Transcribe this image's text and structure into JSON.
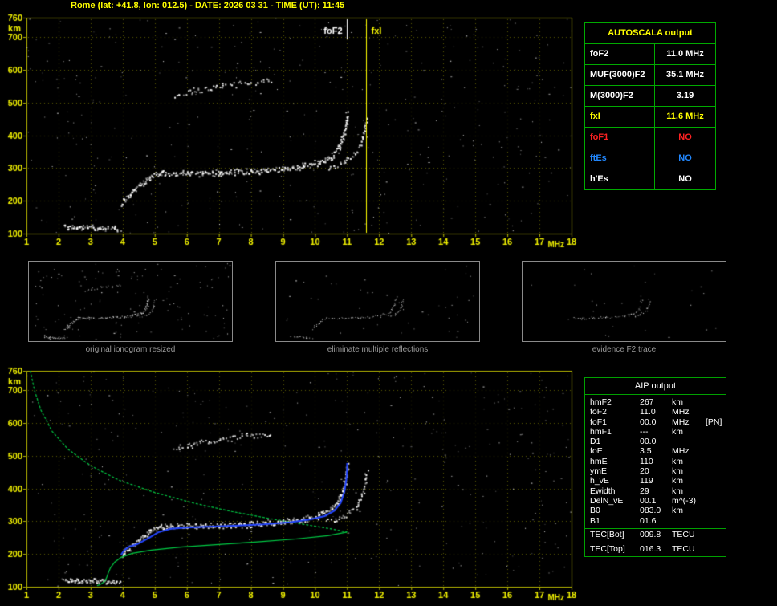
{
  "title": "Rome (lat: +41.8, lon: 012.5) - DATE: 2026 03 31 - TIME (UT): 11:45",
  "colors": {
    "title": "#ffff00",
    "plot_frame": "#b8b800",
    "grid": "#7a7a00",
    "axis_label": "#f0f000",
    "table_border": "#00aa00",
    "caption": "#9a9a9a",
    "profile_green": "#00cc44",
    "trace_blue": "#2244ff",
    "status_red": "#ff2222",
    "status_blue": "#2288ff",
    "status_yellow": "#ffff00",
    "status_white": "#ffffff"
  },
  "autoscala": {
    "header": "AUTOSCALA output",
    "rows": [
      {
        "label": "foF2",
        "value": "11.0 MHz",
        "color": "white"
      },
      {
        "label": "MUF(3000)F2",
        "value": "35.1 MHz",
        "color": "white"
      },
      {
        "label": "M(3000)F2",
        "value": "3.19",
        "color": "white"
      },
      {
        "label": "fxI",
        "value": "11.6 MHz",
        "color": "yellow"
      },
      {
        "label": "foF1",
        "value": "NO",
        "color": "red"
      },
      {
        "label": "ftEs",
        "value": "NO",
        "color": "blue"
      },
      {
        "label": "h'Es",
        "value": "NO",
        "color": "white"
      }
    ]
  },
  "aip": {
    "header": "AIP output",
    "rows": [
      {
        "name": "hmF2",
        "value": "267",
        "unit": "km",
        "note": ""
      },
      {
        "name": "foF2",
        "value": "11.0",
        "unit": "MHz",
        "note": ""
      },
      {
        "name": "foF1",
        "value": "00.0",
        "unit": "MHz",
        "note": "[PN]"
      },
      {
        "name": "hmF1",
        "value": "---",
        "unit": "km",
        "note": ""
      },
      {
        "name": "D1",
        "value": "00.0",
        "unit": "",
        "note": ""
      },
      {
        "name": "foE",
        "value": "3.5",
        "unit": "MHz",
        "note": ""
      },
      {
        "name": "hmE",
        "value": "110",
        "unit": "km",
        "note": ""
      },
      {
        "name": "ymE",
        "value": "20",
        "unit": "km",
        "note": ""
      },
      {
        "name": "h_vE",
        "value": "119",
        "unit": "km",
        "note": ""
      },
      {
        "name": "Ewidth",
        "value": "29",
        "unit": "km",
        "note": ""
      },
      {
        "name": "DelN_vE",
        "value": "00.1",
        "unit": "m^(-3)",
        "note": ""
      },
      {
        "name": "B0",
        "value": "083.0",
        "unit": "km",
        "note": ""
      },
      {
        "name": "B1",
        "value": "01.6",
        "unit": "",
        "note": ""
      }
    ],
    "tec_rows": [
      {
        "name": "TEC[Bot]",
        "value": "009.8",
        "unit": "TECU"
      },
      {
        "name": "TEC[Top]",
        "value": "016.3",
        "unit": "TECU"
      }
    ]
  },
  "captions": [
    "original ionogram resized",
    "eliminate multiple reflections",
    "evidence F2 trace"
  ],
  "chart_data": [
    {
      "id": "main_ionogram",
      "type": "scatter",
      "xlabel": "MHz",
      "ylabel": "km",
      "xlim": [
        1,
        18
      ],
      "ylim": [
        100,
        760
      ],
      "xticks": [
        1,
        2,
        3,
        4,
        5,
        6,
        7,
        8,
        9,
        10,
        11,
        12,
        13,
        14,
        15,
        16,
        17,
        18
      ],
      "yticks": [
        100,
        200,
        300,
        400,
        500,
        600,
        700,
        760
      ],
      "grid": true,
      "markers": [
        {
          "label": "foF2",
          "freq_mhz": 11.0,
          "color": "#ffffff",
          "line": "short",
          "label_side": "left"
        },
        {
          "label": "fxI",
          "freq_mhz": 11.6,
          "color": "#ffff00",
          "line": "full",
          "label_side": "right"
        }
      ],
      "traces": [
        {
          "name": "E-region-echo",
          "points": [
            [
              2.15,
              124
            ],
            [
              2.6,
              121
            ],
            [
              3.2,
              119
            ],
            [
              3.9,
              116
            ]
          ],
          "spread": 4,
          "density": 2
        },
        {
          "name": "F-rise",
          "points": [
            [
              3.95,
              190
            ],
            [
              4.05,
              204
            ],
            [
              4.2,
              220
            ],
            [
              4.5,
              246
            ],
            [
              4.85,
              272
            ],
            [
              5.15,
              286
            ]
          ],
          "spread": 4,
          "density": 2
        },
        {
          "name": "F2-flat",
          "points": [
            [
              5.15,
              287
            ],
            [
              6.0,
              286
            ],
            [
              7.0,
              288
            ],
            [
              8.0,
              292
            ],
            [
              9.0,
              300
            ],
            [
              9.6,
              308
            ],
            [
              10.1,
              319
            ],
            [
              10.5,
              336
            ],
            [
              10.75,
              366
            ],
            [
              10.9,
              406
            ],
            [
              10.97,
              448
            ],
            [
              11.0,
              470
            ]
          ],
          "spread": 5,
          "density": 2
        },
        {
          "name": "F2-xray",
          "points": [
            [
              10.35,
              299
            ],
            [
              10.9,
              318
            ],
            [
              11.25,
              344
            ],
            [
              11.45,
              380
            ],
            [
              11.55,
              422
            ],
            [
              11.6,
              452
            ]
          ],
          "spread": 4,
          "density": 1
        },
        {
          "name": "second-hop",
          "points": [
            [
              5.6,
              522
            ],
            [
              6.3,
              541
            ],
            [
              7.1,
              554
            ],
            [
              7.9,
              562
            ],
            [
              8.6,
              568
            ]
          ],
          "spread": 5,
          "density": 1
        }
      ],
      "noise": {
        "count": 380
      }
    },
    {
      "id": "interpreted_ionogram_with_profile",
      "type": "scatter",
      "xlabel": "MHz",
      "ylabel": "km",
      "xlim": [
        1,
        18
      ],
      "ylim": [
        100,
        760
      ],
      "xticks": [
        1,
        2,
        3,
        4,
        5,
        6,
        7,
        8,
        9,
        10,
        11,
        12,
        13,
        14,
        15,
        16,
        17,
        18
      ],
      "yticks": [
        100,
        200,
        300,
        400,
        500,
        600,
        700,
        760
      ],
      "grid": true,
      "traces_from": 0,
      "noise": {
        "count": 340
      },
      "profile_topside": [
        [
          1.12,
          760
        ],
        [
          1.25,
          700
        ],
        [
          1.45,
          640
        ],
        [
          1.8,
          575
        ],
        [
          2.3,
          520
        ],
        [
          3.0,
          470
        ],
        [
          3.9,
          425
        ],
        [
          5.0,
          388
        ],
        [
          6.2,
          356
        ],
        [
          7.4,
          330
        ],
        [
          8.6,
          308
        ],
        [
          9.7,
          290
        ],
        [
          10.5,
          277
        ],
        [
          11.0,
          267
        ]
      ],
      "profile_bottomside": [
        [
          11.0,
          267
        ],
        [
          10.4,
          256
        ],
        [
          9.4,
          246
        ],
        [
          8.2,
          237
        ],
        [
          7.0,
          229
        ],
        [
          5.8,
          221
        ],
        [
          4.9,
          212
        ],
        [
          4.3,
          202
        ],
        [
          3.95,
          190
        ],
        [
          3.75,
          175
        ],
        [
          3.62,
          158
        ],
        [
          3.55,
          142
        ],
        [
          3.5,
          128
        ],
        [
          3.45,
          118
        ],
        [
          3.38,
          112
        ],
        [
          3.3,
          107
        ],
        [
          3.2,
          103
        ]
      ],
      "restored_trace": [
        [
          3.95,
          198
        ],
        [
          4.05,
          212
        ],
        [
          4.2,
          222
        ],
        [
          4.45,
          230
        ],
        [
          4.8,
          248
        ],
        [
          5.1,
          266
        ],
        [
          5.5,
          277
        ],
        [
          6.0,
          281
        ],
        [
          6.8,
          284
        ],
        [
          7.6,
          287
        ],
        [
          8.4,
          291
        ],
        [
          9.2,
          297
        ],
        [
          9.8,
          305
        ],
        [
          10.3,
          316
        ],
        [
          10.6,
          332
        ],
        [
          10.8,
          356
        ],
        [
          10.92,
          392
        ],
        [
          10.98,
          430
        ],
        [
          11.0,
          462
        ],
        [
          11.0,
          478
        ]
      ]
    },
    {
      "id": "thumb_original_resized",
      "type": "scatter",
      "traces_from": 0,
      "use_traces": [
        "E-region-echo",
        "F-rise",
        "F2-flat",
        "F2-xray",
        "second-hop"
      ],
      "density_scale": 0.8,
      "noise": {
        "count": 130
      }
    },
    {
      "id": "thumb_no_multiple_reflections",
      "type": "scatter",
      "traces_from": 0,
      "use_traces": [
        "E-region-echo",
        "F-rise",
        "F2-flat",
        "F2-xray"
      ],
      "density_scale": 0.7,
      "noise": {
        "count": 45
      }
    },
    {
      "id": "thumb_f2_trace",
      "type": "scatter",
      "traces_from": 0,
      "use_traces": [
        "F2-flat",
        "F2-xray"
      ],
      "density_scale": 0.5,
      "noise": {
        "count": 25
      }
    }
  ]
}
